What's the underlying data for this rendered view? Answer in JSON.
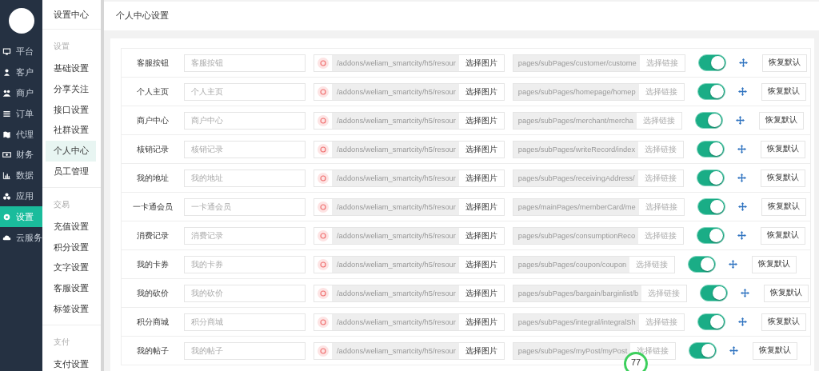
{
  "sidebar": {
    "items": [
      {
        "label": "平台",
        "selected": false
      },
      {
        "label": "客户",
        "selected": false
      },
      {
        "label": "商户",
        "selected": false
      },
      {
        "label": "订单",
        "selected": false
      },
      {
        "label": "代理",
        "selected": false
      },
      {
        "label": "财务",
        "selected": false
      },
      {
        "label": "数据",
        "selected": false
      },
      {
        "label": "应用",
        "selected": false
      },
      {
        "label": "设置",
        "selected": true
      },
      {
        "label": "云服务",
        "selected": false
      }
    ]
  },
  "submenu": {
    "title": "设置中心",
    "sections": [
      {
        "heading": "设置",
        "items": [
          {
            "label": "基础设置",
            "selected": false
          },
          {
            "label": "分享关注",
            "selected": false
          },
          {
            "label": "接口设置",
            "selected": false
          },
          {
            "label": "社群设置",
            "selected": false
          },
          {
            "label": "个人中心",
            "selected": true
          },
          {
            "label": "员工管理",
            "selected": false
          }
        ]
      },
      {
        "heading": "交易",
        "items": [
          {
            "label": "充值设置",
            "selected": false
          },
          {
            "label": "积分设置",
            "selected": false
          },
          {
            "label": "文字设置",
            "selected": false
          },
          {
            "label": "客服设置",
            "selected": false
          },
          {
            "label": "标签设置",
            "selected": false
          }
        ]
      },
      {
        "heading": "支付",
        "items": [
          {
            "label": "支付设置",
            "selected": false
          }
        ]
      }
    ]
  },
  "page_title": "个人中心设置",
  "rows": [
    {
      "label": "客服按钮",
      "placeholder": "客服按钮",
      "image_path": "/addons/weliam_smartcity/h5/resour",
      "image_button": "选择图片",
      "link": "pages/subPages/customer/custome",
      "link_button": "选择链接",
      "on": true,
      "reset_button": "恢复默认"
    },
    {
      "label": "个人主页",
      "placeholder": "个人主页",
      "image_path": "/addons/weliam_smartcity/h5/resour",
      "image_button": "选择图片",
      "link": "pages/subPages/homepage/homep",
      "link_button": "选择链接",
      "on": true,
      "reset_button": "恢复默认"
    },
    {
      "label": "商户中心",
      "placeholder": "商户中心",
      "image_path": "/addons/weliam_smartcity/h5/resour",
      "image_button": "选择图片",
      "link": "pages/subPages/merchant/mercha",
      "link_button": "选择链接",
      "on": true,
      "reset_button": "恢复默认"
    },
    {
      "label": "核销记录",
      "placeholder": "核销记录",
      "image_path": "/addons/weliam_smartcity/h5/resour",
      "image_button": "选择图片",
      "link": "pages/subPages/writeRecord/index",
      "link_button": "选择链接",
      "on": true,
      "reset_button": "恢复默认"
    },
    {
      "label": "我的地址",
      "placeholder": "我的地址",
      "image_path": "/addons/weliam_smartcity/h5/resour",
      "image_button": "选择图片",
      "link": "pages/subPages/receivingAddress/",
      "link_button": "选择链接",
      "on": true,
      "reset_button": "恢复默认"
    },
    {
      "label": "一卡通会员",
      "placeholder": "一卡通会员",
      "image_path": "/addons/weliam_smartcity/h5/resour",
      "image_button": "选择图片",
      "link": "pages/mainPages/memberCard/me",
      "link_button": "选择链接",
      "on": true,
      "reset_button": "恢复默认"
    },
    {
      "label": "消费记录",
      "placeholder": "消费记录",
      "image_path": "/addons/weliam_smartcity/h5/resour",
      "image_button": "选择图片",
      "link": "pages/subPages/consumptionReco",
      "link_button": "选择链接",
      "on": true,
      "reset_button": "恢复默认"
    },
    {
      "label": "我的卡券",
      "placeholder": "我的卡券",
      "image_path": "/addons/weliam_smartcity/h5/resour",
      "image_button": "选择图片",
      "link": "pages/subPages/coupon/coupon",
      "link_button": "选择链接",
      "on": true,
      "reset_button": "恢复默认"
    },
    {
      "label": "我的砍价",
      "placeholder": "我的砍价",
      "image_path": "/addons/weliam_smartcity/h5/resour",
      "image_button": "选择图片",
      "link": "pages/subPages/bargain/barginlist/b",
      "link_button": "选择链接",
      "on": true,
      "reset_button": "恢复默认"
    },
    {
      "label": "积分商城",
      "placeholder": "积分商城",
      "image_path": "/addons/weliam_smartcity/h5/resour",
      "image_button": "选择图片",
      "link": "pages/subPages/integral/integralSh",
      "link_button": "选择链接",
      "on": true,
      "reset_button": "恢复默认"
    },
    {
      "label": "我的帖子",
      "placeholder": "我的帖子",
      "image_path": "/addons/weliam_smartcity/h5/resour",
      "image_button": "选择图片",
      "link": "pages/subPages/myPost/myPost",
      "link_button": "选择链接",
      "on": true,
      "reset_button": "恢复默认"
    }
  ],
  "floating_badge": "77"
}
